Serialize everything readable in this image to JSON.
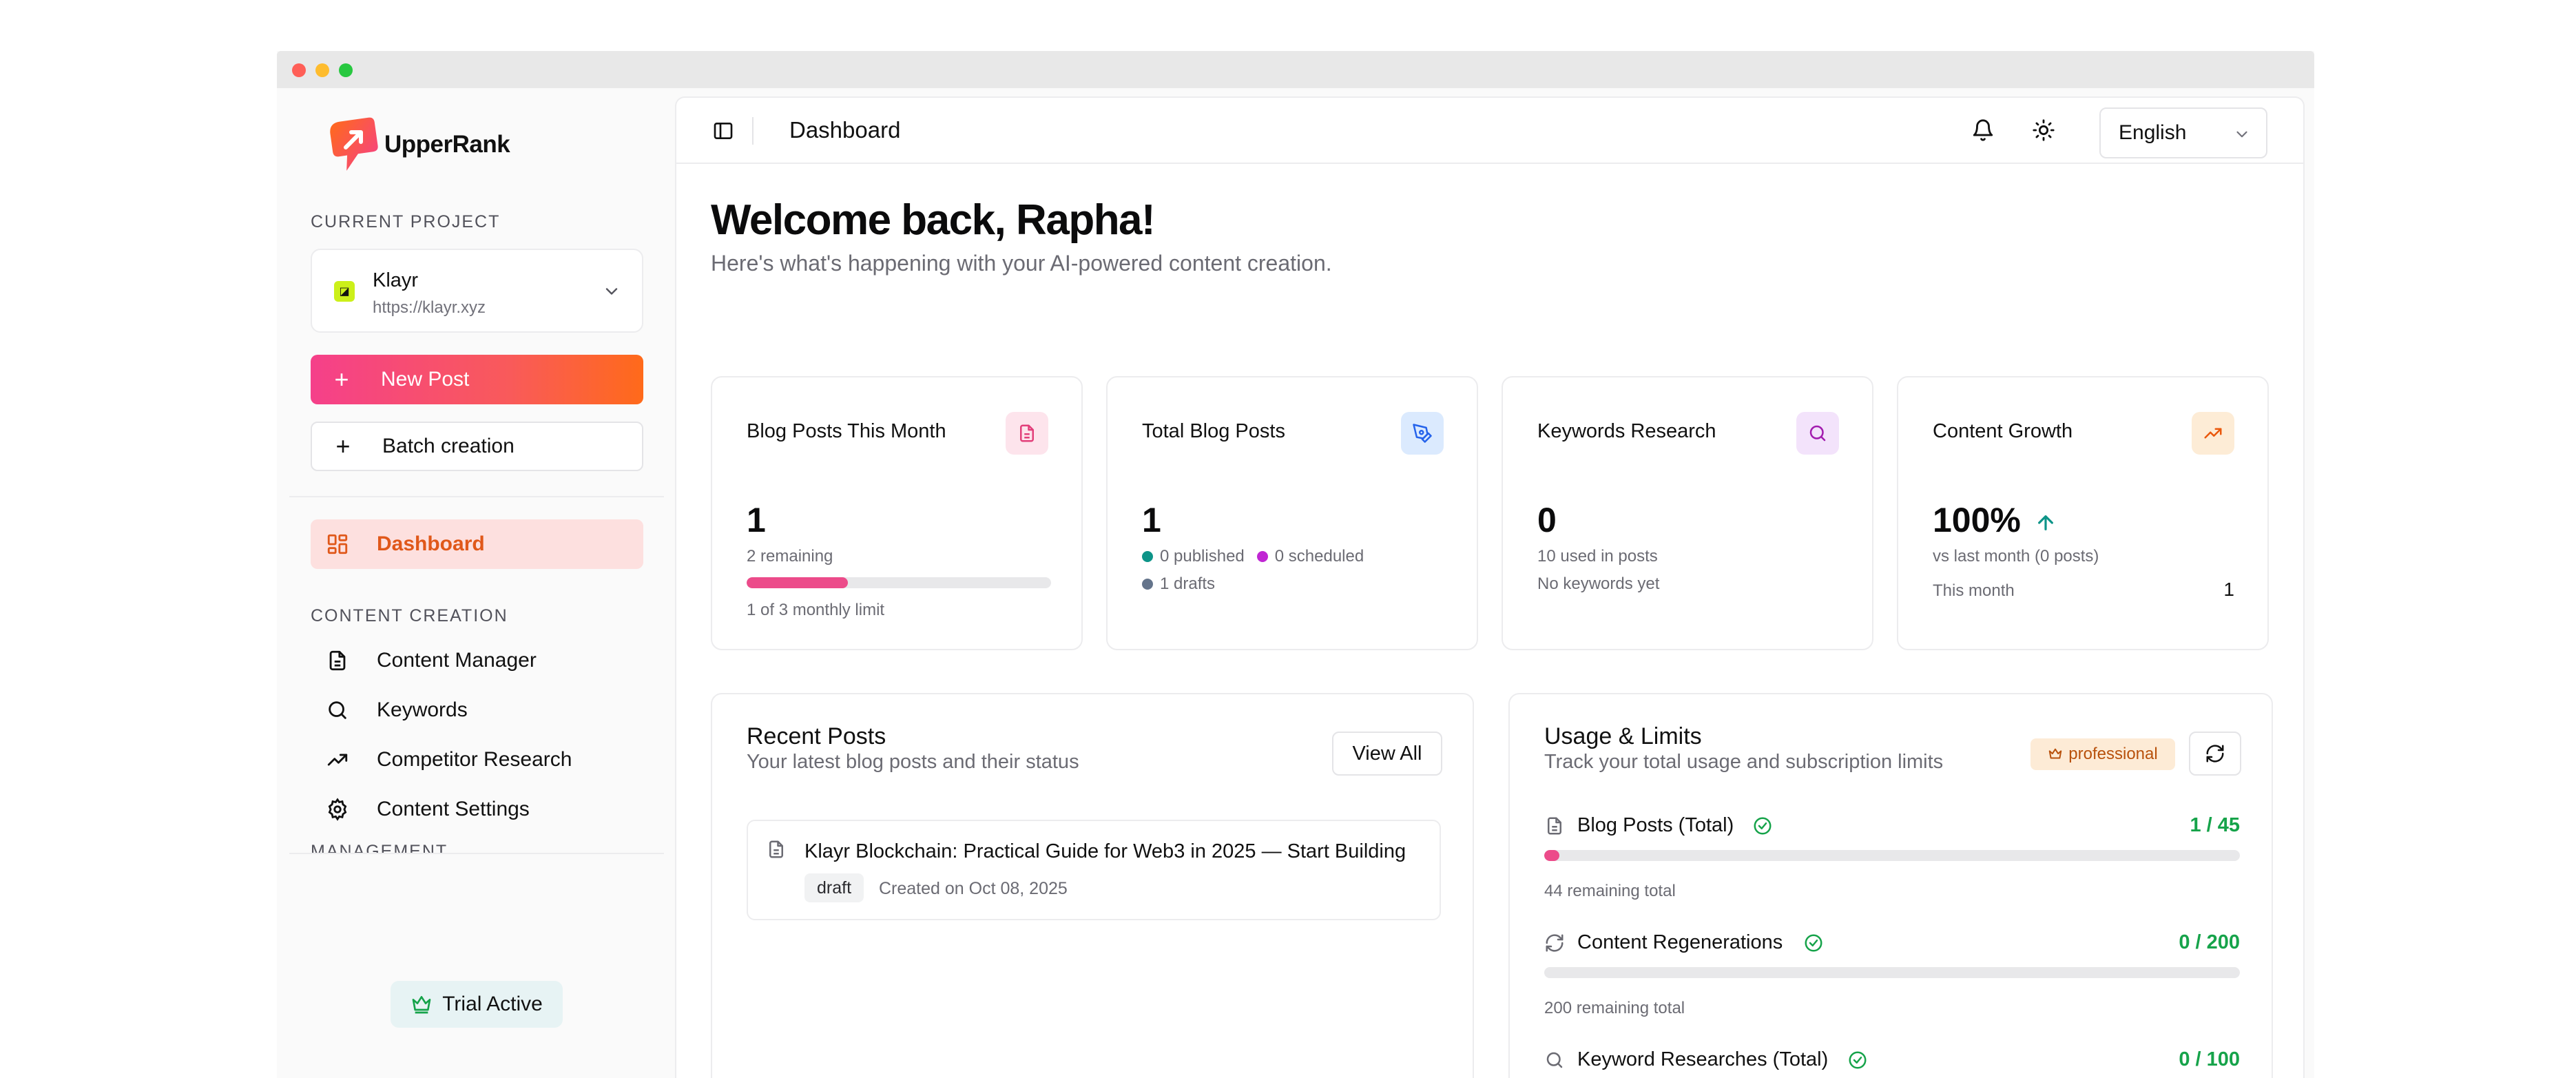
{
  "app": {
    "brand": "UpperRank",
    "colors": {
      "accent": "#f5408a",
      "accent_end": "#ff6a1a",
      "success": "#16a34a"
    }
  },
  "sidebar": {
    "current_project_label": "CURRENT PROJECT",
    "project": {
      "icon_text": "◪",
      "name": "Klayr",
      "url": "https://klayr.xyz"
    },
    "new_post_label": "New Post",
    "batch_label": "Batch creation",
    "dashboard_label": "Dashboard",
    "content_creation_label": "CONTENT CREATION",
    "items": [
      {
        "label": "Content Manager",
        "icon": "document-icon"
      },
      {
        "label": "Keywords",
        "icon": "search-icon"
      },
      {
        "label": "Competitor Research",
        "icon": "trending-up-icon"
      },
      {
        "label": "Content Settings",
        "icon": "gear-icon"
      }
    ],
    "management_label": "MANAGEMENT",
    "trial_label": "Trial Active"
  },
  "topbar": {
    "title": "Dashboard",
    "language": "English"
  },
  "main": {
    "welcome": "Welcome back, Rapha!",
    "subtitle": "Here's what's happening with your AI-powered content creation."
  },
  "stats": {
    "blog_month": {
      "title": "Blog Posts This Month",
      "value": "1",
      "remaining": "2 remaining",
      "limit_text": "1 of 3 monthly limit",
      "progress": 0.333
    },
    "total_posts": {
      "title": "Total Blog Posts",
      "value": "1",
      "published": "0 published",
      "scheduled": "0 scheduled",
      "drafts": "1 drafts"
    },
    "keywords": {
      "title": "Keywords Research",
      "value": "0",
      "used": "10 used in posts",
      "none": "No keywords yet"
    },
    "growth": {
      "title": "Content Growth",
      "value": "100%",
      "vs": "vs last month (0 posts)",
      "this_month_label": "This month",
      "this_month_value": "1"
    }
  },
  "recent": {
    "title": "Recent Posts",
    "subtitle": "Your latest blog posts and their status",
    "view_all": "View All",
    "posts": [
      {
        "title": "Klayr Blockchain: Practical Guide for Web3 in 2025 — Start Building",
        "status": "draft",
        "created": "Created on Oct 08, 2025"
      }
    ]
  },
  "usage": {
    "title": "Usage & Limits",
    "subtitle": "Track your total usage and subscription limits",
    "plan": "professional",
    "items": [
      {
        "label": "Blog Posts (Total)",
        "value": "1 / 45",
        "remaining": "44 remaining total",
        "progress": 0.022
      },
      {
        "label": "Content Regenerations",
        "value": "0 / 200",
        "remaining": "200 remaining total",
        "progress": 0
      },
      {
        "label": "Keyword Researches (Total)",
        "value": "0 / 100",
        "remaining": "",
        "progress": 0
      }
    ]
  }
}
